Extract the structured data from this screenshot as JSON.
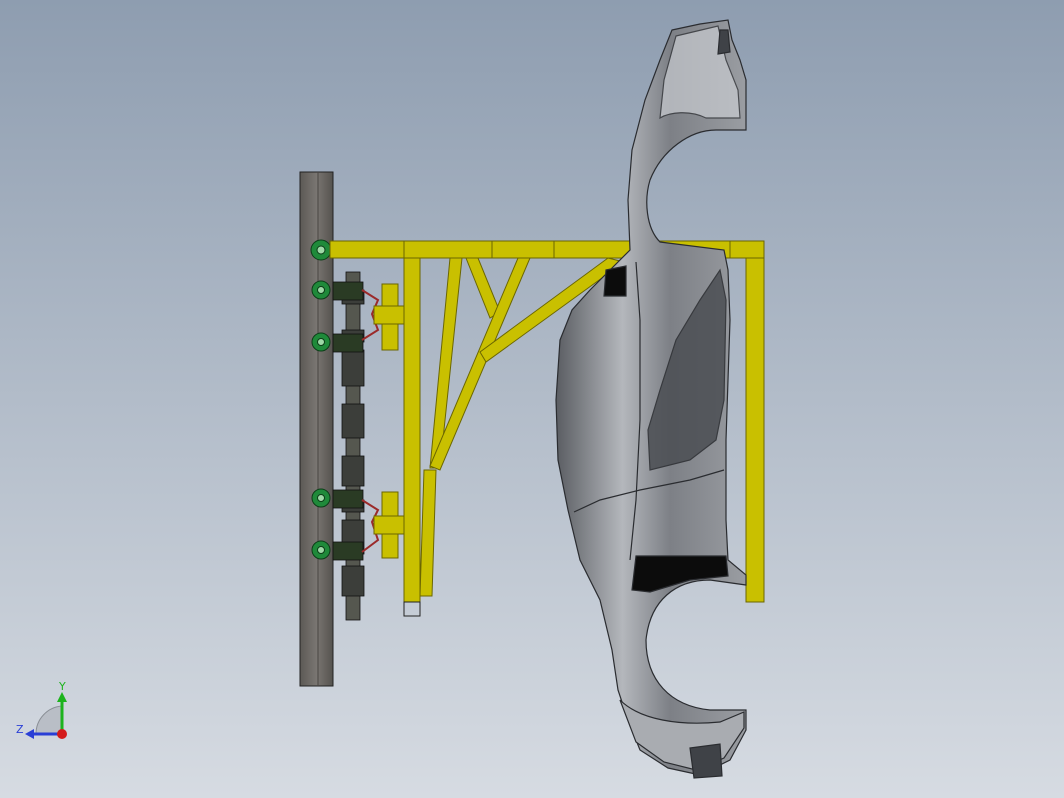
{
  "viewport": {
    "background_top": "#8e9db0",
    "background_bottom": "#d6dbe2"
  },
  "colors": {
    "frame_yellow": "#c9c000",
    "frame_yellow_dark": "#8f8a00",
    "column_gray": "#6e6a66",
    "roller_green": "#1f8a3a",
    "chain_dark": "#3c3e3a",
    "clamp_red": "#9b2a2a",
    "body_gray": "#8a8d92",
    "body_light": "#c9ccd1",
    "body_dark": "#4b4e53"
  },
  "triad": {
    "y_label": "Y",
    "z_label": "Z",
    "y_color": "#1db31d",
    "z_color": "#2a3fd6",
    "x_color": "#d41b1b"
  }
}
